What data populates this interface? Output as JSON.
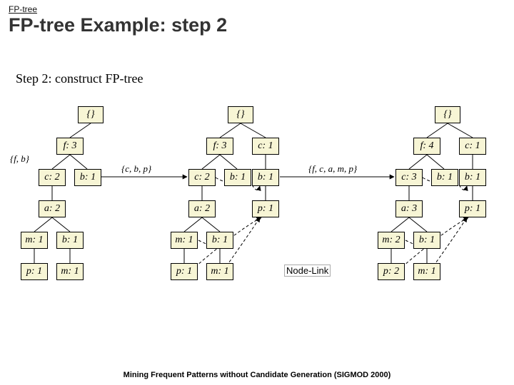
{
  "breadcrumb": "FP-tree",
  "title": "FP-tree Example: step 2",
  "subtitle": "Step 2:  construct   FP-tree",
  "footer": "Mining Frequent Patterns without Candidate Generation (SIGMOD 2000)",
  "page_num": "",
  "link_label": "Node-Link",
  "transactions": {
    "t1": "{f, b}",
    "t2": "{c, b, p}",
    "t3": "{f, c, a, m, p}"
  },
  "trees": {
    "A": {
      "root": "{}",
      "f3": "f: 3",
      "c2": "c: 2",
      "b1": "b: 1",
      "a2": "a: 2",
      "m1": "m: 1",
      "b1b": "b: 1",
      "p1": "p: 1",
      "m1b": "m: 1"
    },
    "B": {
      "root": "{}",
      "f3": "f: 3",
      "c1": "c: 1",
      "c2": "c: 2",
      "b1a": "b: 1",
      "b1b": "b: 1",
      "a2": "a: 2",
      "p1": "p: 1",
      "m1": "m: 1",
      "b1c": "b: 1",
      "p1b": "p: 1",
      "m1b": "m: 1"
    },
    "C": {
      "root": "{}",
      "f4": "f: 4",
      "c1": "c: 1",
      "c3": "c: 3",
      "b1a": "b: 1",
      "b1b": "b: 1",
      "a3": "a: 3",
      "p1": "p: 1",
      "m2": "m: 2",
      "b1c": "b: 1",
      "p2": "p: 2",
      "m1": "m: 1"
    }
  }
}
